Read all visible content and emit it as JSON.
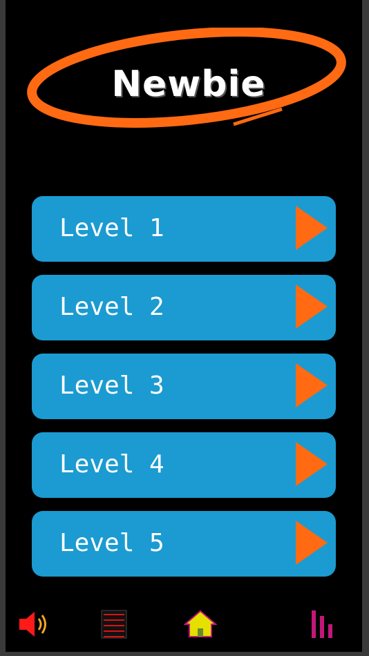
{
  "header": {
    "title": "Newbie"
  },
  "levels": [
    {
      "label": "Level 1"
    },
    {
      "label": "Level 2"
    },
    {
      "label": "Level 3"
    },
    {
      "label": "Level 4"
    },
    {
      "label": "Level 5"
    }
  ],
  "icons": {
    "play": "play-icon",
    "sound": "speaker-icon",
    "menu": "menu-list-icon",
    "home": "home-icon",
    "stats": "bar-stats-icon"
  },
  "colors": {
    "background": "#000000",
    "button": "#1b9bd1",
    "play": "#ff6a13",
    "logo_ring": "#ff6a13",
    "sound_icon": "#ff1a1a",
    "home_icon": "#e6e000",
    "stats_icon": "#c2187a"
  }
}
